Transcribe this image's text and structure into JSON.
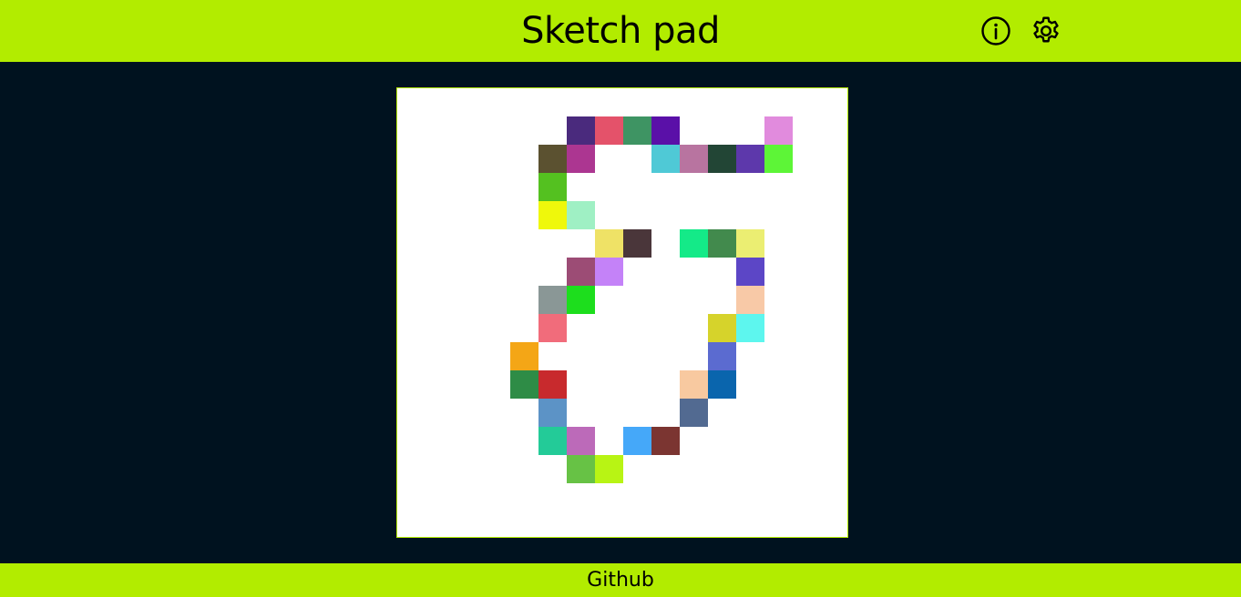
{
  "header": {
    "title": "Sketch pad",
    "info_icon": "info-circle-icon",
    "settings_icon": "gear-icon"
  },
  "footer": {
    "link_label": "Github"
  },
  "colors": {
    "accent": "#b2ec00",
    "background": "#00121f",
    "canvas": "#ffffff"
  },
  "grid": {
    "cols": 16,
    "rows": 16,
    "cells": [
      {
        "c": 6,
        "r": 1,
        "color": "#4a2a7d"
      },
      {
        "c": 7,
        "r": 1,
        "color": "#e4526a"
      },
      {
        "c": 8,
        "r": 1,
        "color": "#3e9463"
      },
      {
        "c": 9,
        "r": 1,
        "color": "#5a10a8"
      },
      {
        "c": 13,
        "r": 1,
        "color": "#e18bdd"
      },
      {
        "c": 5,
        "r": 2,
        "color": "#5b5130"
      },
      {
        "c": 6,
        "r": 2,
        "color": "#ac3691"
      },
      {
        "c": 9,
        "r": 2,
        "color": "#4fc9d6"
      },
      {
        "c": 10,
        "r": 2,
        "color": "#b874a0"
      },
      {
        "c": 11,
        "r": 2,
        "color": "#224535"
      },
      {
        "c": 12,
        "r": 2,
        "color": "#5d38ab"
      },
      {
        "c": 13,
        "r": 2,
        "color": "#5df537"
      },
      {
        "c": 5,
        "r": 3,
        "color": "#54c120"
      },
      {
        "c": 5,
        "r": 4,
        "color": "#eff80b"
      },
      {
        "c": 6,
        "r": 4,
        "color": "#9ff0c4"
      },
      {
        "c": 7,
        "r": 5,
        "color": "#efe266"
      },
      {
        "c": 8,
        "r": 5,
        "color": "#4a363a"
      },
      {
        "c": 10,
        "r": 5,
        "color": "#14ea88"
      },
      {
        "c": 11,
        "r": 5,
        "color": "#428a4d"
      },
      {
        "c": 12,
        "r": 5,
        "color": "#ebee72"
      },
      {
        "c": 6,
        "r": 6,
        "color": "#9c4c75"
      },
      {
        "c": 7,
        "r": 6,
        "color": "#c482f8"
      },
      {
        "c": 12,
        "r": 6,
        "color": "#5c46c6"
      },
      {
        "c": 5,
        "r": 7,
        "color": "#8a9796"
      },
      {
        "c": 6,
        "r": 7,
        "color": "#1dde1d"
      },
      {
        "c": 12,
        "r": 7,
        "color": "#f8c9a7"
      },
      {
        "c": 5,
        "r": 8,
        "color": "#f16c7b"
      },
      {
        "c": 11,
        "r": 8,
        "color": "#d6d32b"
      },
      {
        "c": 12,
        "r": 8,
        "color": "#5df6ee"
      },
      {
        "c": 4,
        "r": 9,
        "color": "#f4a616"
      },
      {
        "c": 11,
        "r": 9,
        "color": "#5b6bd0"
      },
      {
        "c": 4,
        "r": 10,
        "color": "#2e8c46"
      },
      {
        "c": 5,
        "r": 10,
        "color": "#c82a2d"
      },
      {
        "c": 10,
        "r": 10,
        "color": "#f8c9a0"
      },
      {
        "c": 11,
        "r": 10,
        "color": "#0a65ad"
      },
      {
        "c": 5,
        "r": 11,
        "color": "#5c93c6"
      },
      {
        "c": 10,
        "r": 11,
        "color": "#526a91"
      },
      {
        "c": 5,
        "r": 12,
        "color": "#23cb98"
      },
      {
        "c": 6,
        "r": 12,
        "color": "#bc6ab9"
      },
      {
        "c": 8,
        "r": 12,
        "color": "#45a8f9"
      },
      {
        "c": 9,
        "r": 12,
        "color": "#7b3531"
      },
      {
        "c": 6,
        "r": 13,
        "color": "#67c245"
      },
      {
        "c": 7,
        "r": 13,
        "color": "#b8f414"
      }
    ]
  }
}
